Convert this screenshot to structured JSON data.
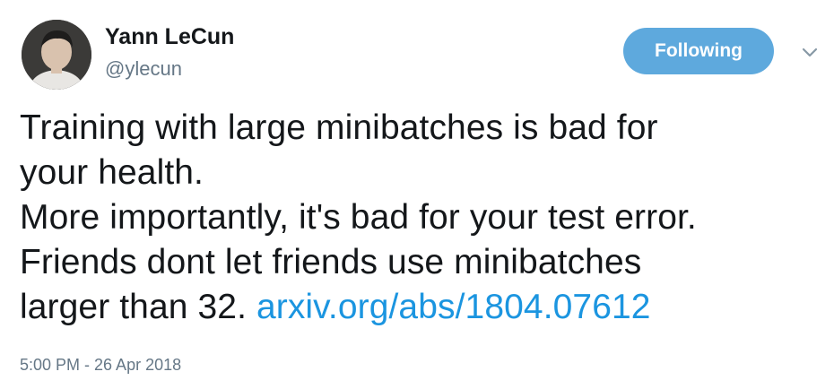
{
  "author": {
    "name": "Yann LeCun",
    "handle": "@ylecun"
  },
  "actions": {
    "follow_label": "Following",
    "menu_icon": "chevron-down-icon"
  },
  "tweet": {
    "line1": "Training with large minibatches is bad for",
    "line2": "your health.",
    "line3": "More importantly, it's bad for your test error.",
    "line4": "Friends dont let friends use minibatches",
    "line5_text": "larger than 32. ",
    "link": "arxiv.org/abs/1804.07612"
  },
  "timestamp": "5:00 PM - 26 Apr 2018",
  "colors": {
    "follow_button": "#5ea9dd",
    "link": "#1b95e0",
    "secondary_text": "#657786",
    "primary_text": "#14171a"
  }
}
